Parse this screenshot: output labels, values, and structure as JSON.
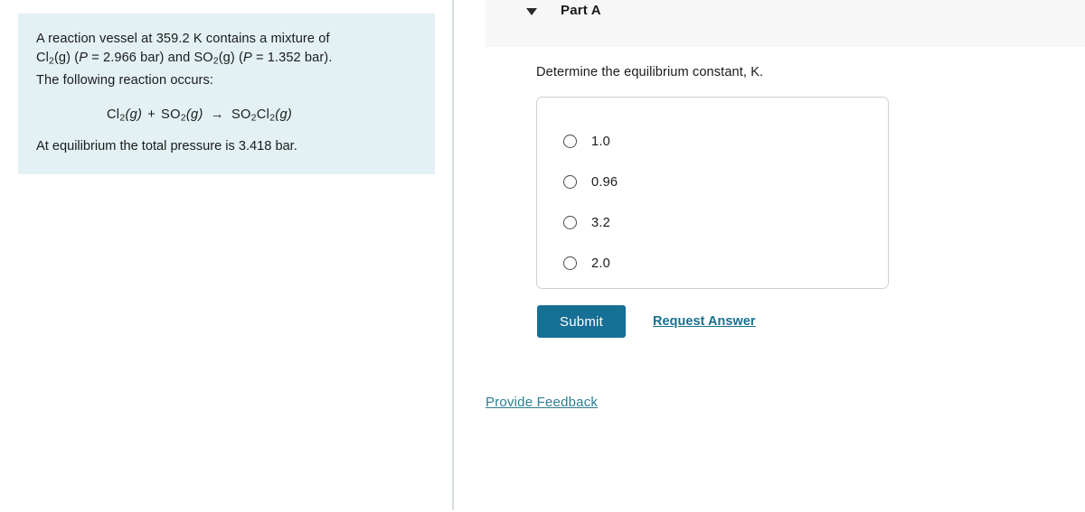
{
  "colors": {
    "problem_card_bg": "#e3f1f4",
    "part_header_bg": "#f7f7f7",
    "submit_bg": "#166f94",
    "link_teal": "#16718f",
    "feedback_teal": "#2d7f94",
    "divider": "#d5dddf",
    "answer_box_border": "#cfcfcf"
  },
  "problem": {
    "line1": "A reaction vessel at 359.2 K contains a mixture of",
    "line2_pre": "Cl",
    "line2_sub1": "2",
    "line2_mid": "(g) (",
    "line2_p1": "P",
    "line2_val1": " = 2.966 bar) and SO",
    "line2_sub2": "2",
    "line2_g2": "(g) (",
    "line2_p2": "P",
    "line2_val2": " = 1.352 bar).",
    "line3": "The following reaction occurs:",
    "equation": {
      "reactant1": "Cl",
      "reactant1_sub": "2",
      "reactant1_state": "(g)",
      "plus": "+",
      "reactant2": "SO",
      "reactant2_sub": "2",
      "reactant2_state": "(g)",
      "arrow": "→",
      "product": "SO",
      "product_sub1": "2",
      "product_mid": "Cl",
      "product_sub2": "2",
      "product_state": "(g)"
    },
    "line4": "At equilibrium the total pressure is 3.418 bar."
  },
  "part": {
    "collapse_icon": "triangle-down-icon",
    "title": "Part A",
    "prompt": "Determine the equilibrium constant, K."
  },
  "answer": {
    "options": [
      {
        "label": "1.0",
        "selected": false
      },
      {
        "label": "0.96",
        "selected": false
      },
      {
        "label": "3.2",
        "selected": false
      },
      {
        "label": "2.0",
        "selected": false
      }
    ]
  },
  "actions": {
    "submit_label": "Submit",
    "request_answer_label": "Request Answer",
    "provide_feedback_label": "Provide Feedback"
  }
}
